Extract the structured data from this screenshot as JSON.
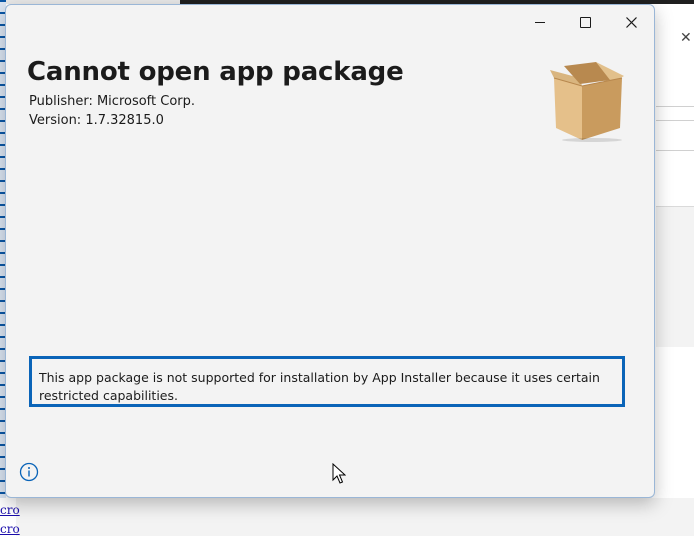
{
  "dialog": {
    "title": "Cannot open app package",
    "publisher": "Publisher: Microsoft Corp.",
    "version": "Version: 1.7.32815.0",
    "message": "This app package is not supported for installation by App Installer because it uses certain restricted capabilities.",
    "icon": "package-box-icon"
  },
  "window_controls": {
    "minimize": "minimize-icon",
    "maximize": "maximize-icon",
    "close": "close-icon"
  },
  "footer": {
    "info_icon": "info-icon"
  },
  "background": {
    "link_text_1": "cro",
    "link_text_2": "cro"
  },
  "colors": {
    "accent": "#0a64b8",
    "dialog_bg": "#f3f3f3",
    "text": "#1b1b1b"
  }
}
